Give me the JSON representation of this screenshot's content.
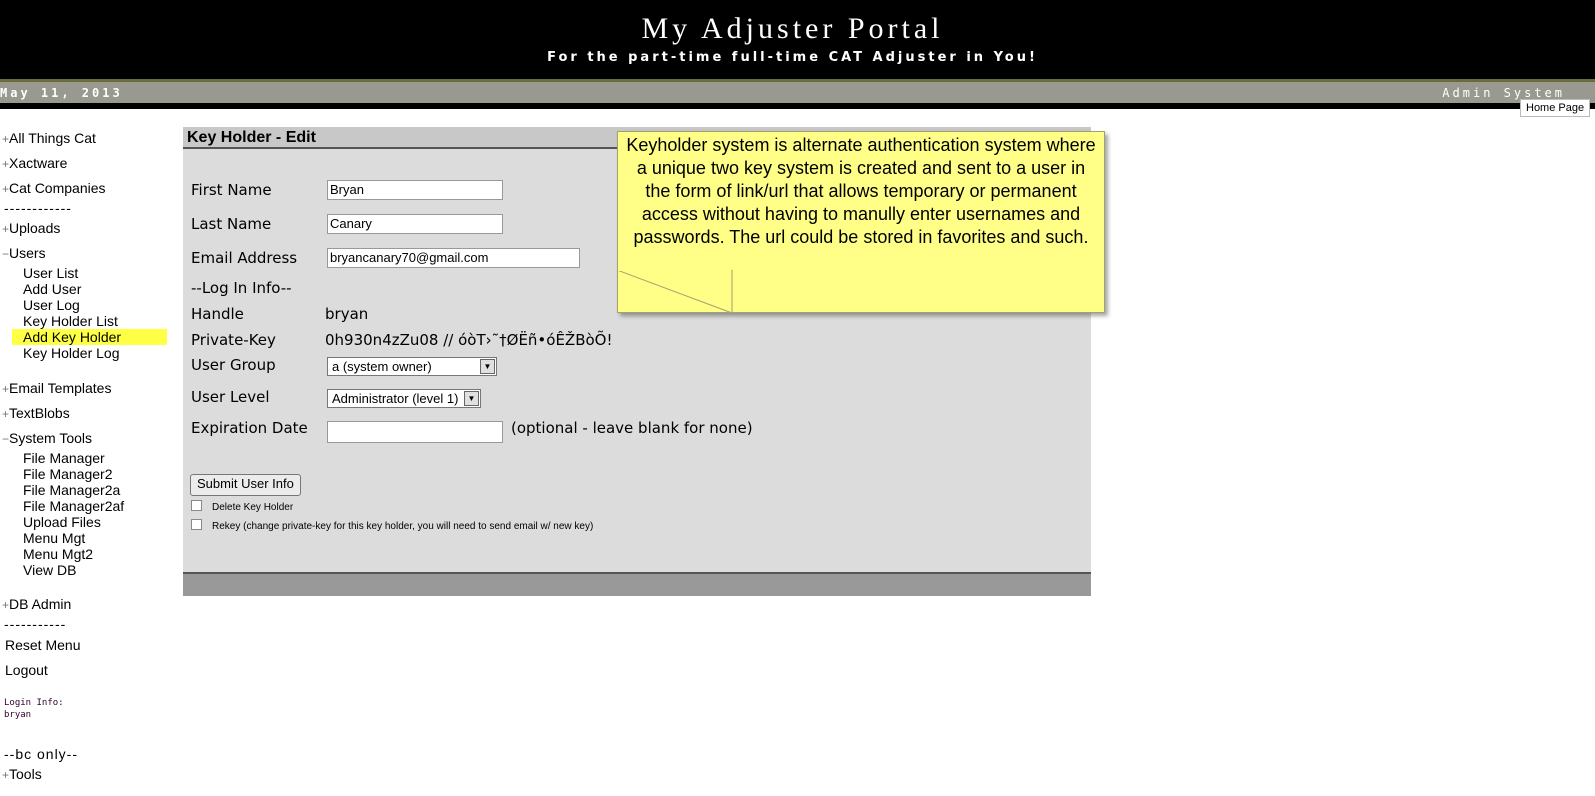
{
  "header": {
    "title": "My Adjuster Portal",
    "tagline": "For the part-time full-time CAT Adjuster in You!"
  },
  "datebar": {
    "date": "May 11, 2013",
    "system": "Admin System"
  },
  "home_page_link": "Home Page",
  "sidebar": {
    "all_things_cat": "All Things Cat",
    "xactware": "Xactware",
    "cat_companies": "Cat Companies",
    "sep1": "------------",
    "uploads": "Uploads",
    "users": "Users",
    "users_sub": [
      "User List",
      "Add User",
      "User Log",
      "Key Holder List",
      "Add Key Holder",
      "Key Holder Log"
    ],
    "email_templates": "Email Templates",
    "textblobs": "TextBlobs",
    "system_tools": "System Tools",
    "system_tools_sub": [
      "File Manager",
      "File Manager2",
      "File Manager2a",
      "File Manager2af",
      "Upload Files",
      "Menu Mgt",
      "Menu Mgt2",
      "View DB"
    ],
    "db_admin": "DB Admin",
    "sep2": "-----------",
    "reset_menu": "Reset Menu",
    "logout": "Logout",
    "login_info_label": "Login Info:",
    "login_info_user": "bryan",
    "bc_only": "--bc only--",
    "tools": "Tools",
    "plus": "+",
    "minus": "−"
  },
  "form": {
    "title": "Key Holder - Edit",
    "first_name_label": "First Name",
    "first_name_value": "Bryan",
    "last_name_label": "Last Name",
    "last_name_value": "Canary",
    "email_label": "Email Address",
    "email_value": "bryancanary70@gmail.com",
    "login_info_heading": "--Log In Info--",
    "handle_label": "Handle",
    "handle_value": "bryan",
    "private_key_label": "Private-Key",
    "private_key_value": "0h930n4zZu08 // óòT›˜†ØËñ•óÊŽBòÕ!",
    "user_group_label": "User Group",
    "user_group_value": "a (system owner)",
    "user_level_label": "User Level",
    "user_level_value": "Administrator (level 1)",
    "expiration_label": "Expiration Date",
    "expiration_value": "",
    "expiration_hint": "(optional - leave blank for none)",
    "submit_label": "Submit User Info",
    "delete_label": "Delete Key Holder",
    "rekey_label": "Rekey (change private-key for this key holder, you will need to send email w/ new key)"
  },
  "callout": {
    "text": "Keyholder system is alternate authentication system where a unique two key system is created and sent to a user in the form of  link/url that allows temporary or permanent access without having to manully enter usernames and passwords.  The url could be stored in favorites and such."
  },
  "colors": {
    "header_bg": "#000000",
    "datebar_bg": "#999990",
    "panel_bg": "#dcdcdc",
    "highlight": "#ffff44",
    "callout_bg": "#ffff88"
  }
}
